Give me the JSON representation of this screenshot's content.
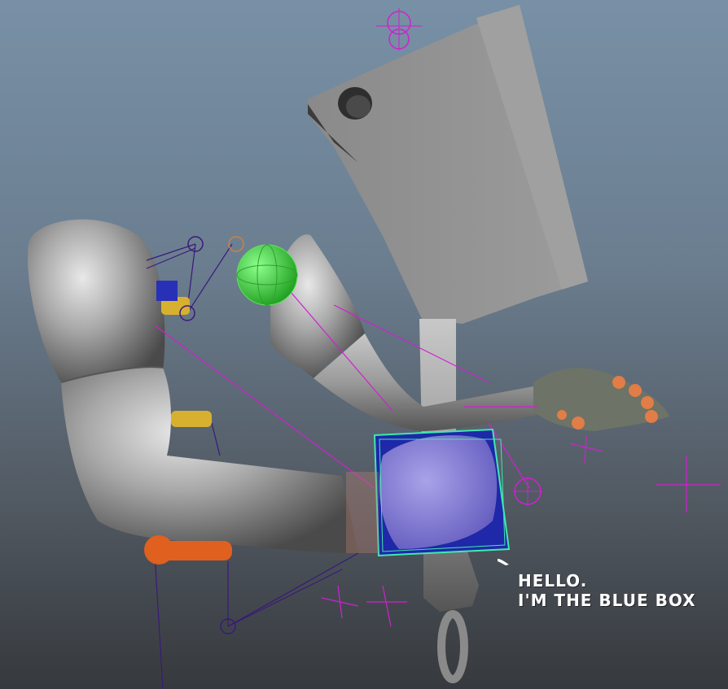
{
  "caption": {
    "line1": "HELLO.",
    "line2": "I'M THE BLUE BOX"
  },
  "colors": {
    "background_top": "#7890a6",
    "background_bottom": "#36393d",
    "mesh_gray": "#9a9a9a",
    "cleaver_gray": "#8e8e8e",
    "rig_magenta": "#d020d0",
    "rig_purple": "#3a1a7a",
    "controller_green": "#3ddc3d",
    "controller_yellow": "#d8b030",
    "controller_orange": "#e06020",
    "blue_box": "#1e28a8",
    "selection_green": "#40e8b0",
    "text_white": "#ffffff"
  },
  "icons": {
    "pointer": "callout-tail-icon"
  }
}
